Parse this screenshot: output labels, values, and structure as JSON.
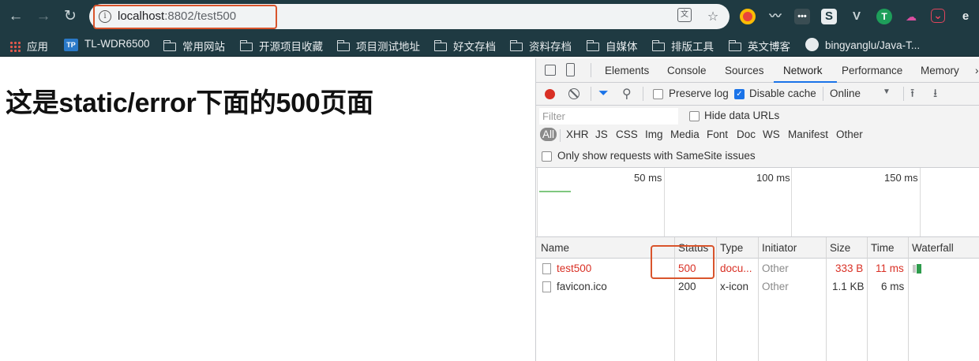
{
  "browser": {
    "url_host": "localhost",
    "url_rest": ":8802/test500"
  },
  "bookmarks": [
    {
      "label": "应用",
      "icon": "apps-grid-icon"
    },
    {
      "label": "TL-WDR6500",
      "icon": "tp-link-icon",
      "icon_text": "TP"
    },
    {
      "label": "常用网站",
      "icon": "folder-icon"
    },
    {
      "label": "开源项目收藏",
      "icon": "folder-icon"
    },
    {
      "label": "项目测试地址",
      "icon": "folder-icon"
    },
    {
      "label": "好文存档",
      "icon": "folder-icon"
    },
    {
      "label": "资料存档",
      "icon": "folder-icon"
    },
    {
      "label": "自媒体",
      "icon": "folder-icon"
    },
    {
      "label": "排版工具",
      "icon": "folder-icon"
    },
    {
      "label": "英文博客",
      "icon": "folder-icon"
    },
    {
      "label": "bingyanglu/Java-T...",
      "icon": "github-icon"
    }
  ],
  "page": {
    "heading": "这是static/error下面的500页面"
  },
  "devtools": {
    "tabs": [
      "Elements",
      "Console",
      "Sources",
      "Network",
      "Performance",
      "Memory"
    ],
    "more_tabs": "›",
    "active_tab": "Network",
    "toolbar": {
      "preserve_log": "Preserve log",
      "disable_cache": "Disable cache",
      "throttle": "Online"
    },
    "filter": {
      "placeholder": "Filter",
      "hide_data_urls": "Hide data URLs",
      "types": [
        "All",
        "XHR",
        "JS",
        "CSS",
        "Img",
        "Media",
        "Font",
        "Doc",
        "WS",
        "Manifest",
        "Other"
      ],
      "samesite": "Only show requests with SameSite issues"
    },
    "overview_ticks": [
      "50 ms",
      "100 ms",
      "150 ms"
    ],
    "columns": [
      "Name",
      "Status",
      "Type",
      "Initiator",
      "Size",
      "Time",
      "Waterfall"
    ],
    "rows": [
      {
        "name": "test500",
        "status": "500",
        "type": "docu...",
        "initiator": "Other",
        "size": "333 B",
        "time": "11 ms",
        "error": true
      },
      {
        "name": "favicon.ico",
        "status": "200",
        "type": "x-icon",
        "initiator": "Other",
        "size": "1.1 KB",
        "time": "6 ms",
        "error": false
      }
    ]
  },
  "colors": {
    "chrome_frame": "#1f3a42",
    "highlight_box": "#d9542c",
    "error_text": "#d93025",
    "record_red": "#d93025",
    "accent_blue": "#1a73e8"
  }
}
